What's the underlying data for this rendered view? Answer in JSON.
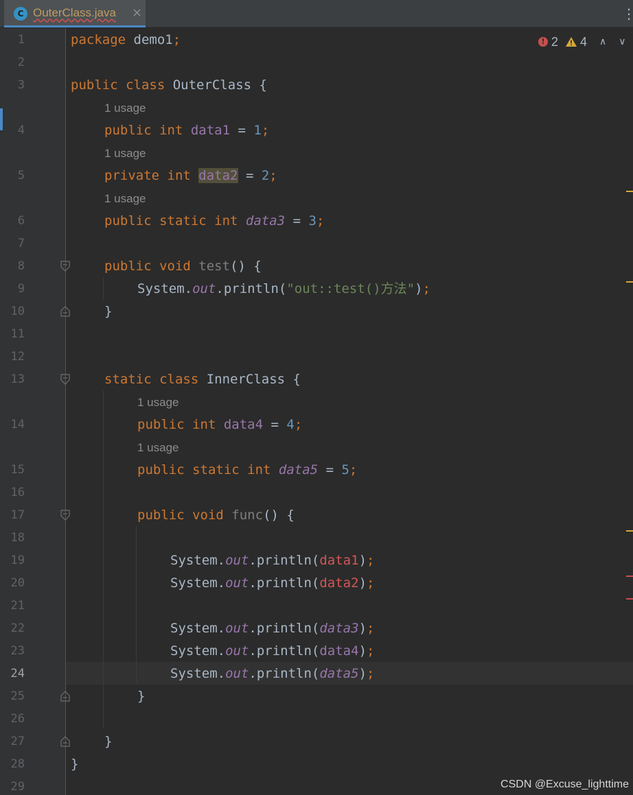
{
  "tab": {
    "icon_letter": "C",
    "filename": "OuterClass.java",
    "close_glyph": "×",
    "more_glyph": "⋮"
  },
  "inspections": {
    "errors": "2",
    "warnings": "4",
    "up_glyph": "∧",
    "down_glyph": "∨"
  },
  "colors": {
    "background": "#2b2b2b",
    "gutter": "#313335",
    "keyword": "#cc7832",
    "field": "#9876aa",
    "number": "#6897bb",
    "string": "#6a8759",
    "error": "#d45656",
    "warning": "#d6a83a"
  },
  "line_numbers": [
    "1",
    "2",
    "3",
    "4",
    "5",
    "6",
    "7",
    "8",
    "9",
    "10",
    "11",
    "12",
    "13",
    "14",
    "15",
    "16",
    "17",
    "18",
    "19",
    "20",
    "21",
    "22",
    "23",
    "24",
    "25",
    "26",
    "27",
    "28",
    "29"
  ],
  "current_line": "24",
  "usage_hint": "1 usage",
  "code": {
    "l1": {
      "kw": "package",
      "rest": " demo1",
      "semi": ";"
    },
    "l3": {
      "kw": "public class",
      "rest": " OuterClass {"
    },
    "l4": {
      "kw": "public int",
      "field": "data1",
      "eq": " = ",
      "num": "1",
      "semi": ";"
    },
    "l5": {
      "kw": "private int",
      "field": "data2",
      "eq": " = ",
      "num": "2",
      "semi": ";"
    },
    "l6": {
      "kw": "public static int",
      "field": "data3",
      "eq": " = ",
      "num": "3",
      "semi": ";"
    },
    "l8": {
      "kw": "public void",
      "method": "test",
      "rest": "() {"
    },
    "l9": {
      "sys": "System.",
      "out": "out",
      "call": ".println(",
      "str": "\"out::test()方法\"",
      "close": ")",
      "semi": ";"
    },
    "l10": {
      "text": "}"
    },
    "l13": {
      "kw": "static class",
      "rest": " InnerClass {"
    },
    "l14": {
      "kw": "public int",
      "field": "data4",
      "eq": " = ",
      "num": "4",
      "semi": ";"
    },
    "l15": {
      "kw": "public static int",
      "field": "data5",
      "eq": " = ",
      "num": "5",
      "semi": ";"
    },
    "l17": {
      "kw": "public void",
      "method": "func",
      "rest": "() {"
    },
    "l19": {
      "sys": "System.",
      "out": "out",
      "call": ".println(",
      "arg": "data1",
      "close": ")",
      "semi": ";"
    },
    "l20": {
      "sys": "System.",
      "out": "out",
      "call": ".println(",
      "arg": "data2",
      "close": ")",
      "semi": ";"
    },
    "l22": {
      "sys": "System.",
      "out": "out",
      "call": ".println(",
      "arg": "data3",
      "close": ")",
      "semi": ";"
    },
    "l23": {
      "sys": "System.",
      "out": "out",
      "call": ".println(",
      "arg": "data4",
      "close": ")",
      "semi": ";"
    },
    "l24": {
      "sys": "System.",
      "out": "out",
      "call": ".println(",
      "arg": "data5",
      "close": ")",
      "semi": ";"
    },
    "l25": {
      "text": "}"
    },
    "l27": {
      "text": "}"
    },
    "l28": {
      "text": "}"
    }
  },
  "watermark": "CSDN @Excuse_lighttime"
}
